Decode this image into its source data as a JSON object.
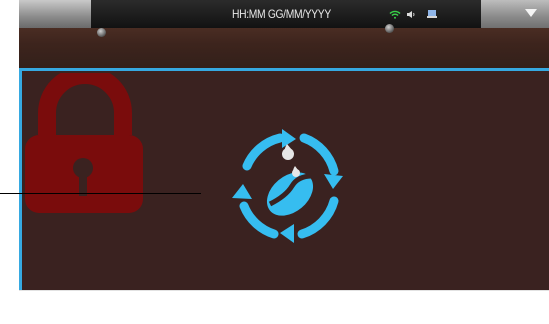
{
  "status_bar": {
    "datetime": "HH:MM GG/MM/YYYY",
    "icons": [
      "wifi-icon",
      "speaker-icon",
      "usb-icon"
    ]
  },
  "header": {
    "menu_icon": "chevron-down-icon"
  },
  "main": {
    "lock_icon": "lock-icon",
    "status_icon": "coffee-bean-refresh-icon"
  },
  "colors": {
    "accent": "#36a9e1",
    "panel_bg": "#3a2220",
    "lock": "#7a0c0c",
    "wood": "#3d241d"
  }
}
